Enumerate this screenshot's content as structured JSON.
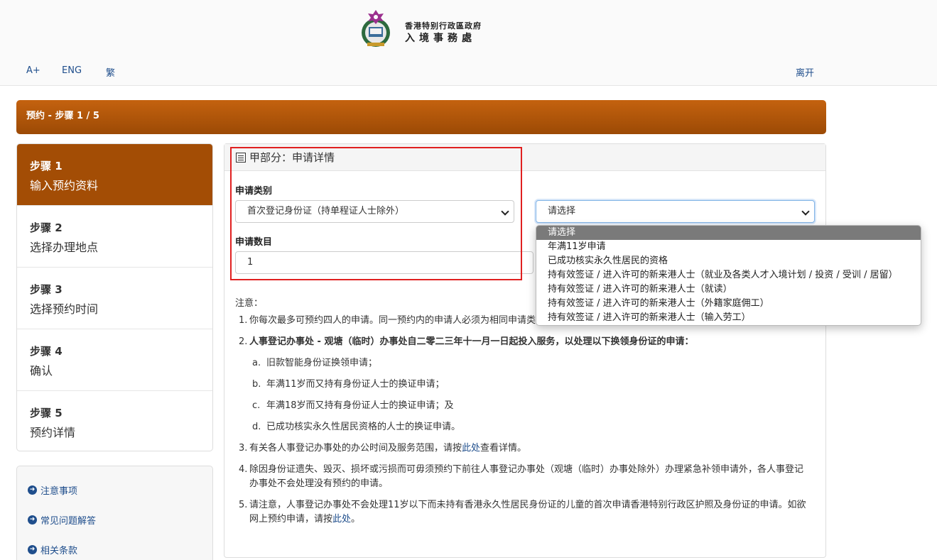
{
  "header": {
    "gov_name": "香港特别行政區政府",
    "dept_name": "入境事務處",
    "font_size": "A+",
    "lang_eng": "ENG",
    "lang_trad": "繁",
    "exit": "离开"
  },
  "banner": {
    "title": "预约 - 步骤 1 / 5"
  },
  "steps": [
    {
      "num": "步骤 1",
      "label": "输入预约资料",
      "active": true
    },
    {
      "num": "步骤 2",
      "label": "选择办理地点"
    },
    {
      "num": "步骤 3",
      "label": "选择预约时间"
    },
    {
      "num": "步骤 4",
      "label": "确认"
    },
    {
      "num": "步骤 5",
      "label": "预约详情"
    }
  ],
  "links": [
    "注意事项",
    "常见问题解答",
    "相关条款"
  ],
  "panel": {
    "title": "甲部分：申请详情",
    "category_label": "申请类别",
    "category_value": "首次登记身份证（持单程证人士除外）",
    "subcategory_value": "请选择",
    "count_label": "申请数目",
    "count_value": "1"
  },
  "dropdown": {
    "options": [
      "请选择",
      "年满11岁申请",
      "已成功核实永久性居民的资格",
      "持有效签证 / 进入许可的新来港人士（就业及各类人才入境计划 / 投资 / 受训 / 居留）",
      "持有效签证 / 进入许可的新来港人士（就读）",
      "持有效签证 / 进入许可的新来港人士（外籍家庭佣工）",
      "持有效签证 / 进入许可的新来港人士（输入劳工）"
    ],
    "selected_index": 0
  },
  "notes": {
    "heading": "注意：",
    "n1_num": "1.",
    "n1": "你每次最多可预约四人的申请。同一预约内的申请人必须为相同申请类别。",
    "n2_num": "2.",
    "n2": "人事登记办事处 - 观塘（临时）办事处自二零二三年十一月一日起投入服务，以处理以下换领身份证的申请：",
    "n2a_num": "a.",
    "n2a": "旧款智能身份证换领申请；",
    "n2b_num": "b.",
    "n2b": "年满11岁而又持有身份证人士的换证申请；",
    "n2c_num": "c.",
    "n2c": "年满18岁而又持有身份证人士的换证申请；及",
    "n2d_num": "d.",
    "n2d": "已成功核实永久性居民资格的人士的换证申请。",
    "n3_num": "3.",
    "n3_pre": "有关各人事登记办事处的办公时间及服务范围，请按",
    "n3_link": "此处",
    "n3_post": "查看详情。",
    "n4_num": "4.",
    "n4": "除因身份证遗失、毁灭、损坏或污损而可毋须预约下前往人事登记办事处（观塘（临时）办事处除外）办理紧急补领申请外，各人事登记办事处不会处理没有预约的申请。",
    "n5_num": "5.",
    "n5_pre": "请注意，人事登记办事处不会处理11岁以下而未持有香港永久性居民身份证的儿童的首次申请香港特别行政区护照及身份证的申请。如欲网上预约申请，请按",
    "n5_link": "此处",
    "n5_post": "。"
  },
  "colors": {
    "accent": "#a34d05",
    "link": "#1f4e8c",
    "highlight": "#e02020"
  }
}
